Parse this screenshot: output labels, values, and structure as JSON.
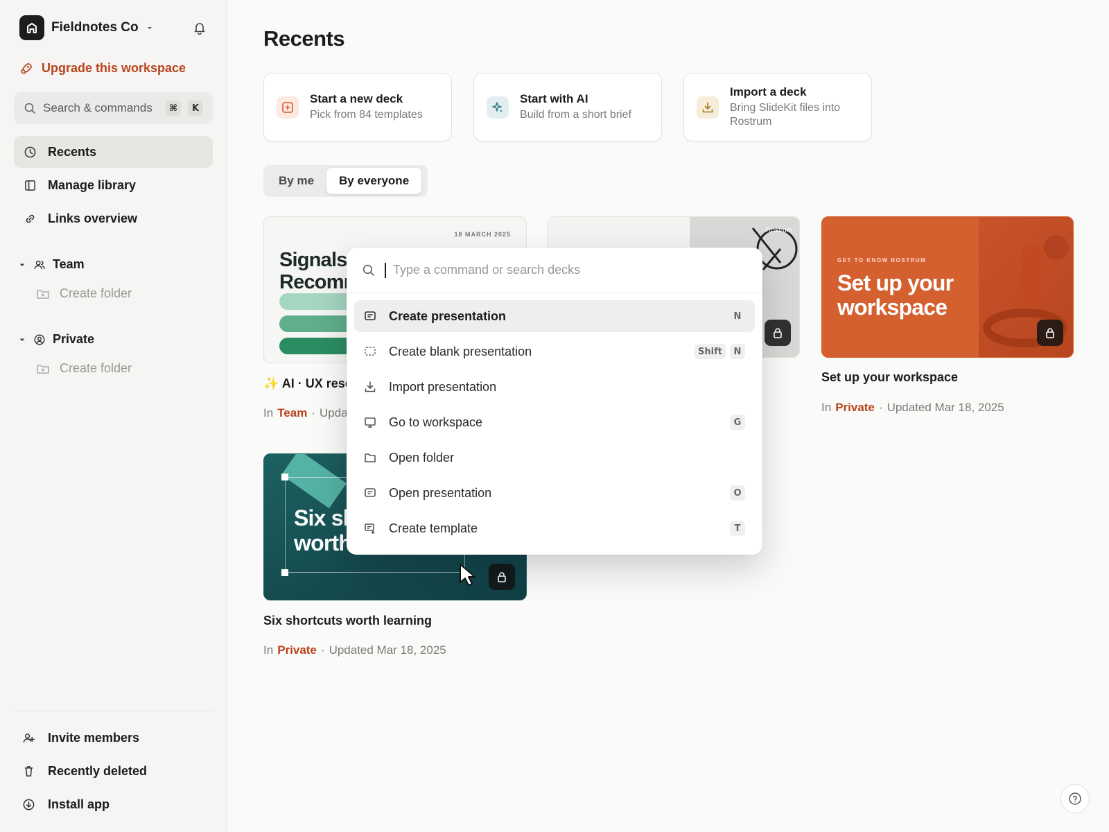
{
  "sidebar": {
    "workspace_name": "Fieldnotes Co",
    "upgrade_label": "Upgrade this workspace",
    "search": {
      "label": "Search & commands",
      "key1": "⌘",
      "key2": "K"
    },
    "nav": [
      {
        "label": "Recents",
        "icon": "clock-icon",
        "active": true
      },
      {
        "label": "Manage library",
        "icon": "library-icon"
      },
      {
        "label": "Links overview",
        "icon": "link-icon"
      }
    ],
    "groups": [
      {
        "label": "Team",
        "folder_label": "Create folder"
      },
      {
        "label": "Private",
        "folder_label": "Create folder"
      }
    ],
    "bottom": [
      {
        "label": "Invite members",
        "icon": "invite-icon"
      },
      {
        "label": "Recently deleted",
        "icon": "trash-icon"
      },
      {
        "label": "Install app",
        "icon": "download-icon"
      }
    ]
  },
  "main": {
    "title": "Recents",
    "quick_actions": [
      {
        "title": "Start a new deck",
        "subtitle": "Pick from 84 templates",
        "icon": "plus-square-icon",
        "color": "#d9572b"
      },
      {
        "title": "Start with AI",
        "subtitle": "Build from a short brief",
        "icon": "sparkle-icon",
        "color": "#2f7a86"
      },
      {
        "title": "Import a deck",
        "subtitle": "Bring SlideKit files into Rostrum",
        "icon": "import-icon",
        "color": "#a57516"
      }
    ],
    "filter": {
      "by_me": "By me",
      "by_everyone": "By everyone",
      "selected": "By everyone"
    },
    "decks": [
      {
        "title": "AI · UX rese",
        "emoji": "✨",
        "location": "Team",
        "prefix": "In",
        "updated": "Upda",
        "thumb_date": "18 MARCH 2025",
        "thumb_line1": "Signals",
        "thumb_line2": "Recomr"
      },
      {
        "title": "",
        "thumb_label": "Rostrum"
      },
      {
        "title": "Set up your workspace",
        "location": "Private",
        "prefix": "In",
        "updated": "Updated Mar 18, 2025",
        "thumb_kicker": "GET TO KNOW ROSTRUM",
        "thumb_line1": "Set up your",
        "thumb_line2": "workspace"
      },
      {
        "title": "Six shortcuts worth learning",
        "location": "Private",
        "prefix": "In",
        "updated": "Updated Mar 18, 2025",
        "thumb_line1": "Six sh",
        "thumb_line2": "worth"
      }
    ]
  },
  "palette": {
    "placeholder": "Type a command or search decks",
    "items": [
      {
        "label": "Create presentation",
        "icon": "presentation-icon",
        "keys": [
          "N"
        ],
        "selected": true
      },
      {
        "label": "Create blank presentation",
        "icon": "blank-slide-icon",
        "keys": [
          "Shift",
          "N"
        ]
      },
      {
        "label": "Import presentation",
        "icon": "import-icon",
        "keys": []
      },
      {
        "label": "Go to workspace",
        "icon": "monitor-icon",
        "keys": [
          "G"
        ]
      },
      {
        "label": "Open folder",
        "icon": "folder-icon",
        "keys": []
      },
      {
        "label": "Open presentation",
        "icon": "presentation-icon",
        "keys": [
          "O"
        ]
      },
      {
        "label": "Create template",
        "icon": "template-icon",
        "keys": [
          "T"
        ]
      }
    ]
  },
  "colors": {
    "accent": "#b8441b",
    "teal": "#1f5a5a",
    "orange": "#d9572b"
  }
}
